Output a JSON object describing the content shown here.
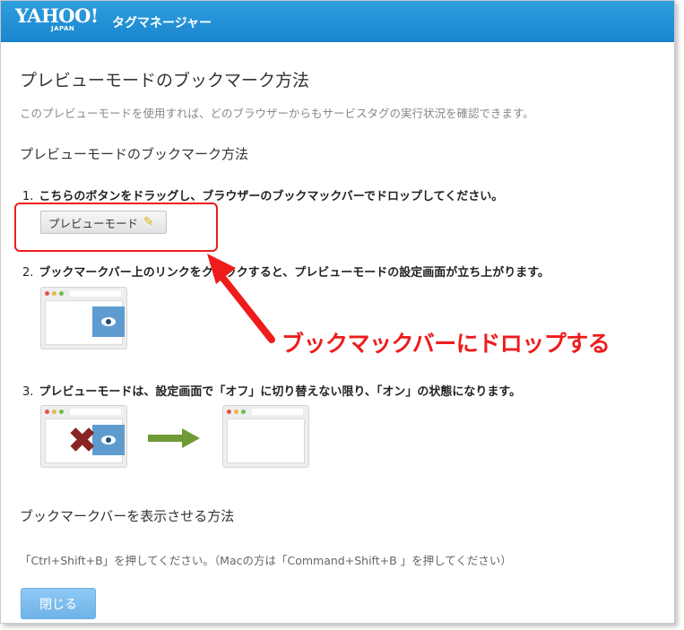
{
  "header": {
    "logo_text": "YAHOO!",
    "logo_sub": "JAPAN",
    "product_name": "タグマネージャー"
  },
  "dialog": {
    "title": "プレビューモードのブックマーク方法",
    "description": "このプレビューモードを使用すれば、どのブラウザーからもサービスタグの実行状況を確認できます。",
    "section_title": "プレビューモードのブックマーク方法",
    "steps": [
      {
        "number": "1.",
        "text": "こちらのボタンをドラッグし、ブラウザーのブックマックバーでドロップしてください。"
      },
      {
        "number": "2.",
        "text": "ブックマークバー上のリンクをクリックすると、プレビューモードの設定画面が立ち上がります。"
      },
      {
        "number": "3.",
        "text": "プレビューモードは、設定画面で「オフ」に切り替えない限り、「オン」の状態になります。"
      }
    ],
    "bookmarklet_label": "プレビューモード",
    "bookmark_bar_title": "ブックマークバーを表示させる方法",
    "bookmark_bar_hint": "「Ctrl+Shift+B」を押してください。（Macの方は「Command+Shift+B 」を押してください）",
    "close_label": "閉じる"
  },
  "annotation": {
    "text": "ブックマックバーにドロップする",
    "color": "#ef1c1c"
  },
  "colors": {
    "header_blue": "#1a86cf",
    "accent_blue": "#5e9cd0",
    "arrow_green": "#6f9a35",
    "cross_red": "#8a2424"
  },
  "icons": {
    "pencil": "pencil-icon",
    "eye": "eye-icon",
    "cross": "cross-icon",
    "arrow": "arrow-right-icon"
  }
}
